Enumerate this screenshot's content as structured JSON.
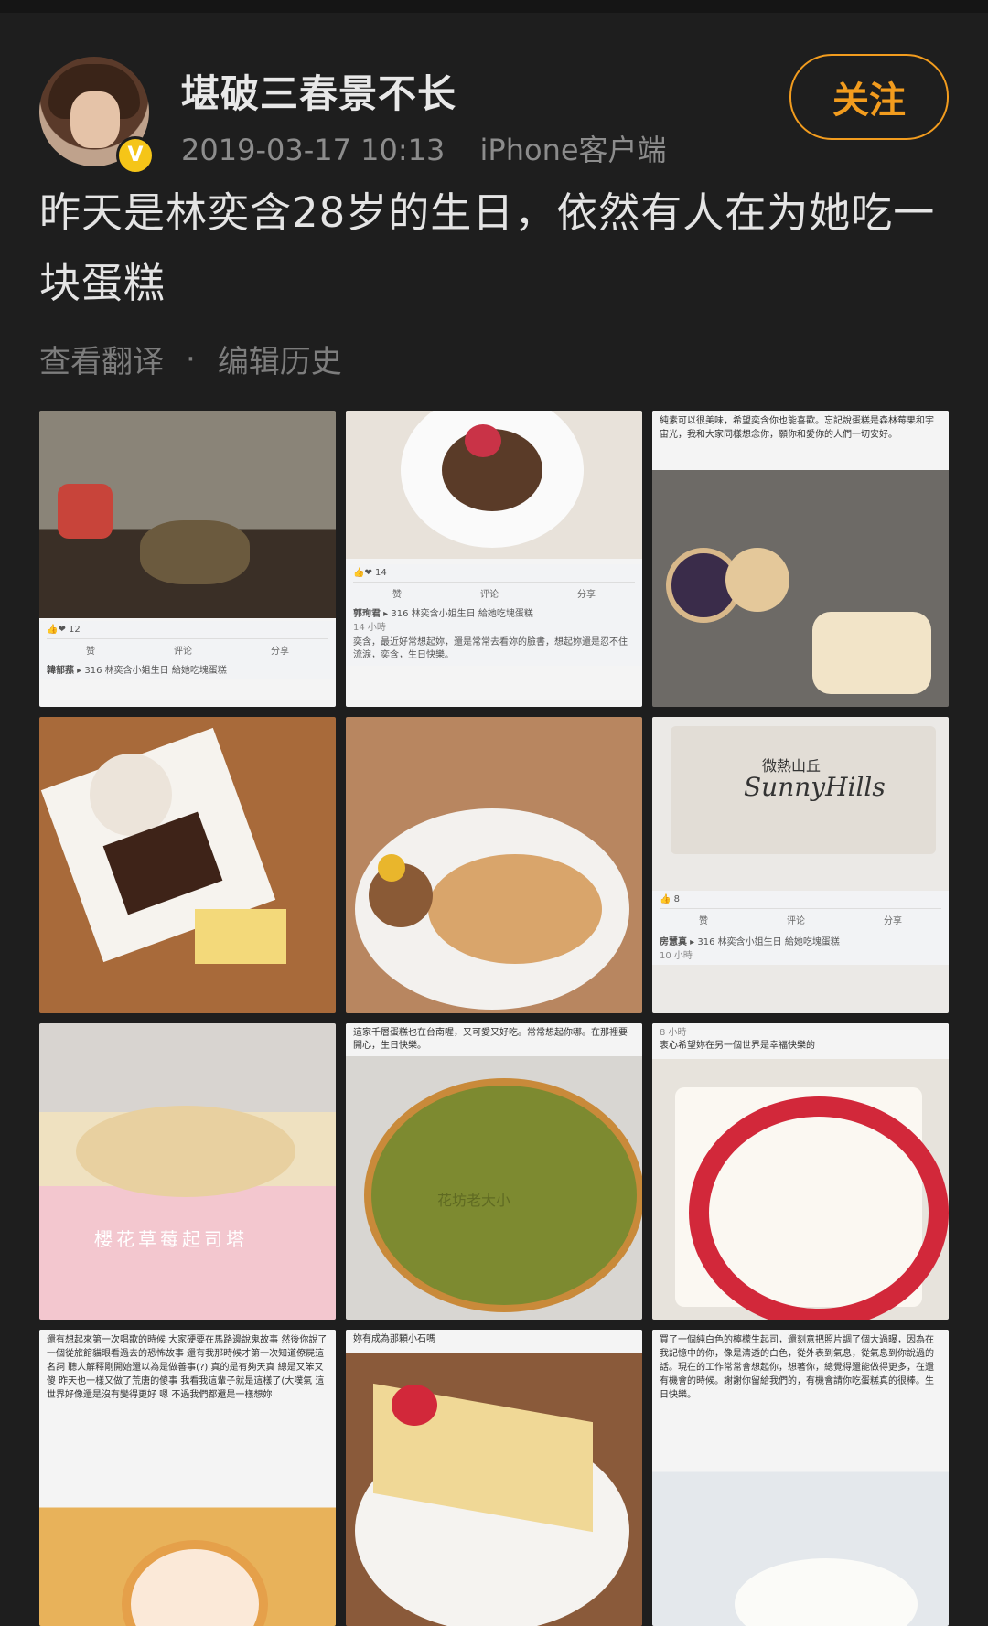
{
  "user": {
    "name": "堪破三春景不长",
    "timestamp": "2019-03-17 10:13",
    "client": "iPhone客户端",
    "verified_badge": "V"
  },
  "follow_button": "关注",
  "post_text": "昨天是林奕含28岁的生日，依然有人在为她吃一块蛋糕",
  "actions": {
    "translate": "查看翻译",
    "separator": "·",
    "edit_history": "编辑历史"
  },
  "colors": {
    "accent": "#f29c1e",
    "background": "#1e1e1e"
  },
  "images": [
    {
      "like_count": "12",
      "like": "赞",
      "comment": "评论",
      "share": "分享",
      "poster": "韓郁蓀",
      "group": "316 林奕含小姐生日 給她吃塊蛋糕"
    },
    {
      "like_count": "14",
      "like": "赞",
      "comment": "评论",
      "share": "分享",
      "poster": "郭珣君",
      "group": "316 林奕含小姐生日 給她吃塊蛋糕",
      "time": "14 小時",
      "caption": "奕含，最近好常想起妳，還是常常去看妳的臉書，想起妳還是忍不住流淚，奕含，生日快樂。"
    },
    {
      "caption": "純素可以很美味，希望奕含你也能喜歡。忘記說蛋糕是森林莓果和宇宙光，我和大家同樣想念你，願你和愛你的人們一切安好。"
    },
    {},
    {},
    {
      "box_text_zh": "微熱山丘",
      "box_text_en": "SunnyHills",
      "like_count": "8",
      "like": "赞",
      "comment": "评论",
      "share": "分享",
      "poster": "房慧真",
      "group": "316 林奕含小姐生日 給她吃塊蛋糕",
      "time": "10 小時"
    },
    {
      "label": "櫻花草莓起司塔"
    },
    {
      "caption": "這家千層蛋糕也在台南喔，又可愛又好吃。常常想起你哪。在那裡要開心，生日快樂。",
      "cake_text": "花坊老大小"
    },
    {
      "time": "8 小時",
      "caption": "衷心希望妳在另一個世界是幸福快樂的"
    },
    {
      "caption": "還有想起來第一次唱歌的時候 大家硬要在馬路邊說鬼故事 然後你說了一個從旅館貓眼看過去的恐怖故事 還有我那時候才第一次知道僚屍這名詞 聽人解釋剛開始還以為是做善事(?) 真的是有夠天真 總是又笨又傻 昨天也一樣又做了荒唐的傻事 我看我這輩子就是這樣了(大噗氣 這世界好像還是沒有變得更好 嗯 不過我們都還是一樣想妳"
    },
    {
      "caption": "妳有成為那顆小石嗎"
    },
    {
      "caption": "買了一個純白色的檸檬生起司，還刻意把照片調了個大過曝，因為在我記憶中的你，像是清透的白色，從外表到氣息，從氣息到你說過的話。現在的工作常常會想起你，想著你，總覺得還能做得更多，在還有機會的時候。謝謝你留給我們的，有機會請你吃蛋糕真的很棒。生日快樂。"
    }
  ]
}
